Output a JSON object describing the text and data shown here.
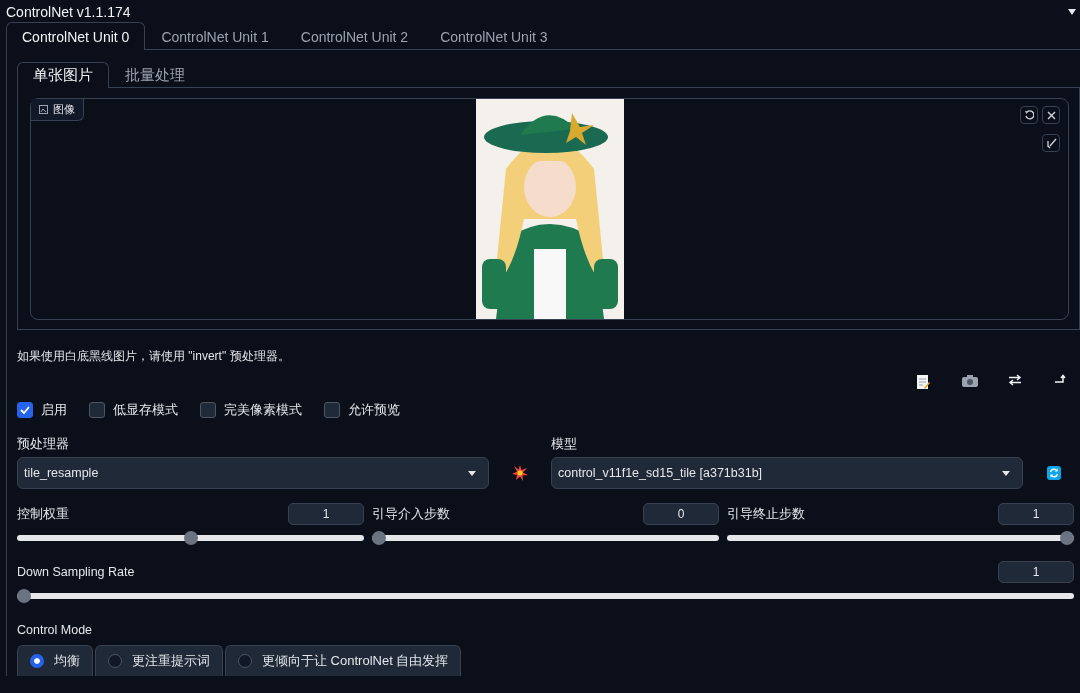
{
  "title": "ControlNet v1.1.174",
  "unit_tabs": [
    {
      "label": "ControlNet Unit 0",
      "selected": true
    },
    {
      "label": "ControlNet Unit 1",
      "selected": false
    },
    {
      "label": "ControlNet Unit 2",
      "selected": false
    },
    {
      "label": "ControlNet Unit 3",
      "selected": false
    }
  ],
  "image_tabs": [
    {
      "label": "单张图片",
      "selected": true
    },
    {
      "label": "批量处理",
      "selected": false
    }
  ],
  "image_panel": {
    "label": "图像"
  },
  "hint": "如果使用白底黑线图片，请使用 \"invert\" 预处理器。",
  "options": [
    {
      "label": "启用",
      "checked": true
    },
    {
      "label": "低显存模式",
      "checked": false
    },
    {
      "label": "完美像素模式",
      "checked": false
    },
    {
      "label": "允许预览",
      "checked": false
    }
  ],
  "preprocessor": {
    "label": "预处理器",
    "value": "tile_resample"
  },
  "model": {
    "label": "模型",
    "value": "control_v11f1e_sd15_tile [a371b31b]"
  },
  "sliders": [
    {
      "label": "控制权重",
      "reading": "1",
      "level": 0.5
    },
    {
      "label": "引导介入步数",
      "reading": "0",
      "level": 0
    },
    {
      "label": "引导终止步数",
      "reading": "1",
      "level": 1
    }
  ],
  "down_sampling": {
    "label": "Down Sampling Rate",
    "reading": "1",
    "level": 0
  },
  "control_mode": {
    "label": "Control Mode",
    "options": [
      {
        "label": "均衡",
        "selected": true
      },
      {
        "label": "更注重提示词",
        "selected": false
      },
      {
        "label": "更倾向于让 ControlNet 自由发挥",
        "selected": false
      }
    ]
  }
}
